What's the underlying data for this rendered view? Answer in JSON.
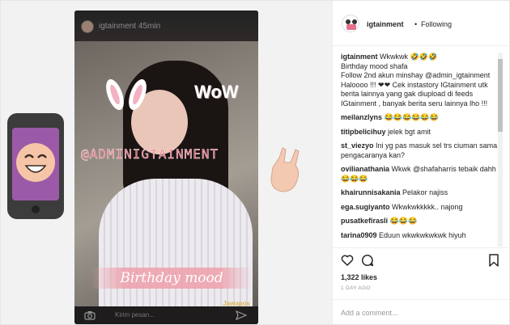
{
  "post": {
    "author": "igtainment",
    "separator": "•",
    "follow_status": "Following",
    "caption_user": "igtainment",
    "caption_text": "Wkwkwk 🤣🤣🤣\nBirthday mood shafa\nFollow 2nd akun minshay @admin_igtainment Haloooo !!! ❤❤ Cek instastory IGtainment utk berita lainnya yang gak diupload di feeds IGtainment , banyak berita seru lainnya lho !!!"
  },
  "story": {
    "username": "igtainment 45min",
    "sticker_wow": "WoW",
    "sticker_mention": "@ADMINIGTAINMENT",
    "sticker_birthday": "Birthday mood",
    "watermark": "Jawapos",
    "reply_placeholder": "Kirim pesan..."
  },
  "comments": [
    {
      "user": "meilanzlyns",
      "text": "😂😂😂😂😂😂"
    },
    {
      "user": "titipbelicihuy",
      "text": "jelek bgt amit"
    },
    {
      "user": "st_viezyo",
      "text": "Ini yg pas masuk sel trs ciuman sama pengacaranya kan?"
    },
    {
      "user": "ovilianathania",
      "text": "Wkwk @shafaharris tebaik dahh 😂😂😂"
    },
    {
      "user": "khairunnisakania",
      "text": "Pelakor najiss"
    },
    {
      "user": "ega.sugiyanto",
      "text": "Wkwkwkkkkk.. najong"
    },
    {
      "user": "pusatkefirasli",
      "text": "😂😂😂"
    },
    {
      "user": "tarina0909",
      "text": "Eduun wkwkwkwkwk hiyuh"
    }
  ],
  "engagement": {
    "likes": "1,322 likes",
    "date": "1 DAY AGO"
  },
  "composer": {
    "placeholder": "Add a comment..."
  },
  "icons": {
    "like": "heart-icon",
    "comment": "comment-icon",
    "save": "bookmark-icon",
    "camera": "camera-icon",
    "send": "send-icon"
  },
  "colors": {
    "mention_pink": "#e25d6f",
    "muted_text": "#999999",
    "border": "#efefef"
  }
}
